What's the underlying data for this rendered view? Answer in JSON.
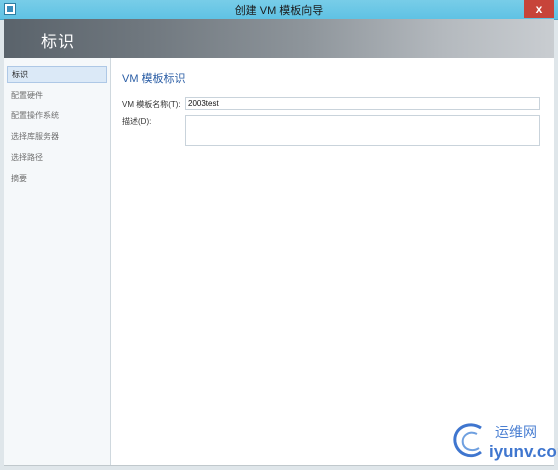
{
  "window": {
    "title": "创建 VM 模板向导",
    "close_glyph": "x"
  },
  "banner": {
    "title": "标识"
  },
  "sidebar": {
    "items": [
      {
        "label": "标识",
        "active": true
      },
      {
        "label": "配置硬件",
        "active": false
      },
      {
        "label": "配置操作系统",
        "active": false
      },
      {
        "label": "选择库服务器",
        "active": false
      },
      {
        "label": "选择路径",
        "active": false
      },
      {
        "label": "摘要",
        "active": false
      }
    ]
  },
  "main": {
    "section_title": "VM 模板标识",
    "name_label": "VM 模板名称(T):",
    "name_value": "2003test",
    "description_label": "描述(D):",
    "description_value": ""
  },
  "watermark": {
    "top_text": "运维网",
    "bottom_text": "iyunv.com"
  },
  "colors": {
    "titlebar": "#6ecbe8",
    "accent": "#2a5da5",
    "close": "#c7443a"
  }
}
